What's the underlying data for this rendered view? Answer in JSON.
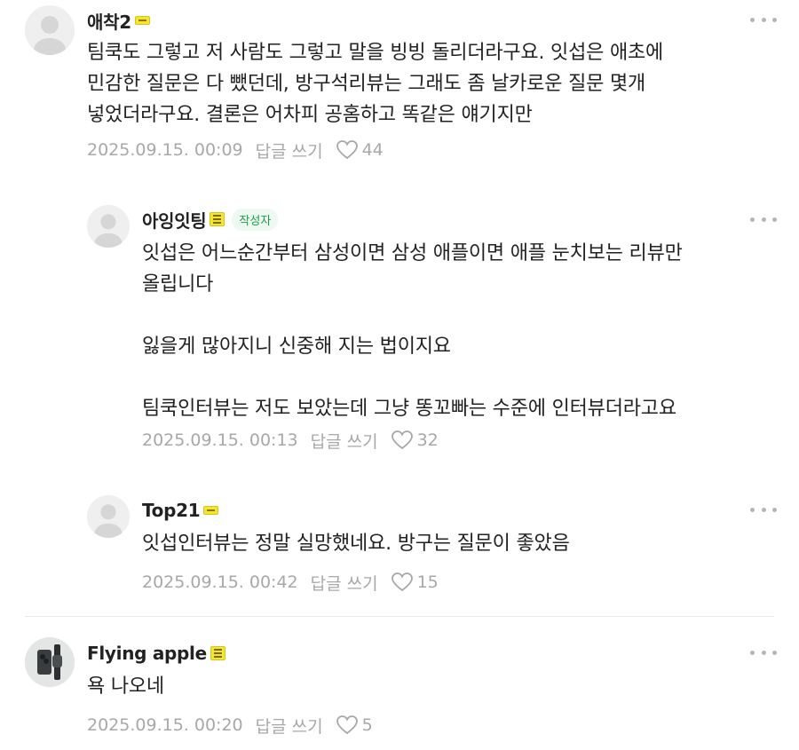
{
  "comments": [
    {
      "author": "애착2",
      "body": "팀쿡도 그렇고 저 사람도 그렇고 말을 빙빙 돌리더라구요. 잇섭은 애초에\n민감한 질문은 다 뺐던데, 방구석리뷰는 그래도 좀 날카로운 질문 몇개\n넣었더라구요. 결론은 어차피 공홈하고 똑같은 얘기지만",
      "timestamp": "2025.09.15. 00:09",
      "reply_label": "답글 쓰기",
      "likes": "44"
    },
    {
      "author": "아잉잇팅",
      "author_badge": "작성자",
      "body": "잇섭은 어느순간부터 삼성이면 삼성 애플이면 애플 눈치보는 리뷰만\n올립니다\n\n잃을게 많아지니 신중해 지는 법이지요\n\n팀쿡인터뷰는 저도 보았는데 그냥 똥꼬빠는 수준에 인터뷰더라고요",
      "timestamp": "2025.09.15. 00:13",
      "reply_label": "답글 쓰기",
      "likes": "32"
    },
    {
      "author": "Top21",
      "body": "잇섭인터뷰는 정말 실망했네요. 방구는 질문이 좋았음",
      "timestamp": "2025.09.15. 00:42",
      "reply_label": "답글 쓰기",
      "likes": "15"
    },
    {
      "author": "Flying apple",
      "body": "욕 나오네",
      "timestamp": "2025.09.15. 00:20",
      "reply_label": "답글 쓰기",
      "likes": "5"
    }
  ],
  "colors": {
    "text": "#222222",
    "meta": "#a8a8a8",
    "badge_green": "#19a04a",
    "level_yellow": "#f4e533"
  },
  "icons": [
    "default-avatar-icon",
    "phone-watch-avatar-icon",
    "level-badge-icon",
    "heart-icon",
    "more-dots-icon"
  ]
}
